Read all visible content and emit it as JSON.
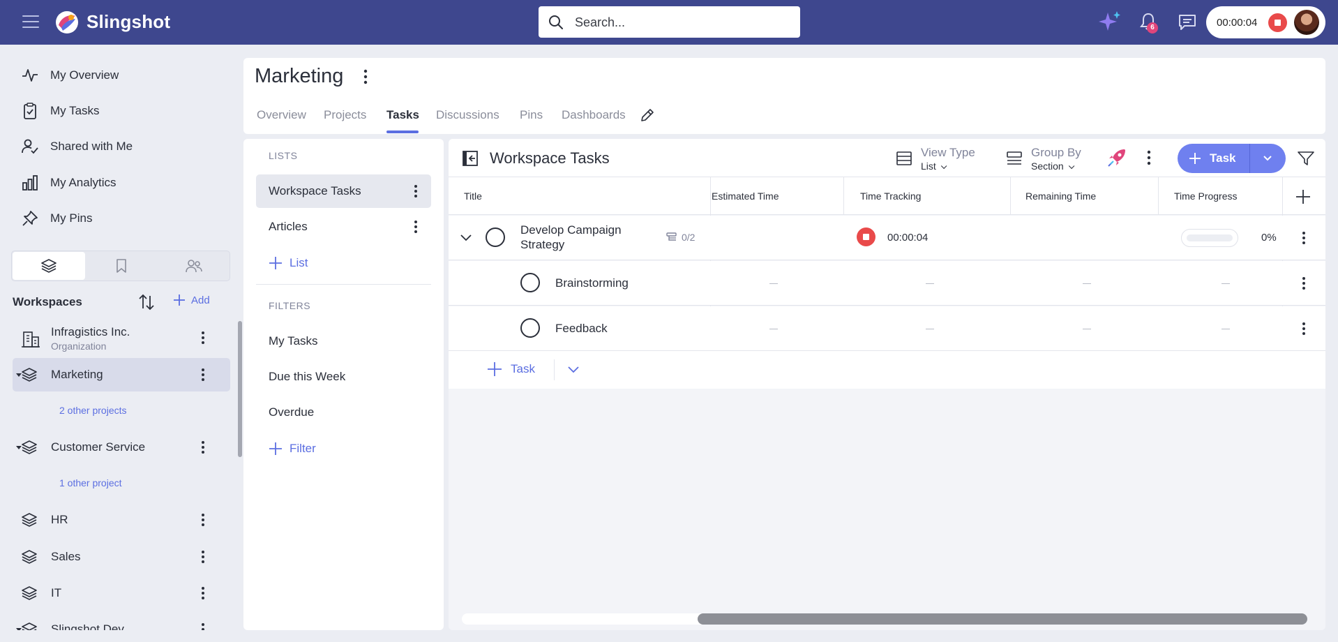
{
  "app": {
    "brand": "Slingshot"
  },
  "search": {
    "placeholder": "Search..."
  },
  "topbar": {
    "notifications_count": "6",
    "timer": "00:00:04"
  },
  "nav": {
    "items": [
      {
        "label": "My Overview",
        "icon": "activity-icon"
      },
      {
        "label": "My Tasks",
        "icon": "clipboard-check-icon"
      },
      {
        "label": "Shared with Me",
        "icon": "user-check-icon"
      },
      {
        "label": "My Analytics",
        "icon": "bar-chart-icon"
      },
      {
        "label": "My Pins",
        "icon": "pin-icon"
      }
    ]
  },
  "workspaces": {
    "title": "Workspaces",
    "add_label": "Add",
    "items": [
      {
        "name": "Infragistics Inc.",
        "sub": "Organization",
        "icon": "building-icon"
      },
      {
        "name": "Marketing",
        "icon": "layers-icon",
        "link": "2 other projects"
      },
      {
        "name": "Customer Service",
        "icon": "layers-icon",
        "link": "1 other project"
      },
      {
        "name": "HR",
        "icon": "layers-icon"
      },
      {
        "name": "Sales",
        "icon": "layers-icon"
      },
      {
        "name": "IT",
        "icon": "layers-icon"
      },
      {
        "name": "Slingshot Dev",
        "icon": "layers-icon"
      }
    ]
  },
  "page": {
    "title": "Marketing",
    "tabs": [
      "Overview",
      "Projects",
      "Tasks",
      "Discussions",
      "Pins",
      "Dashboards"
    ],
    "active_tab": "Tasks"
  },
  "lists": {
    "lists_label": "LISTS",
    "items": [
      "Workspace Tasks",
      "Articles"
    ],
    "add_list_label": "List",
    "filters_label": "FILTERS",
    "filters": [
      "My Tasks",
      "Due this Week",
      "Overdue"
    ],
    "add_filter_label": "Filter"
  },
  "main": {
    "title": "Workspace Tasks",
    "view_type_label": "View Type",
    "view_type_value": "List",
    "group_by_label": "Group By",
    "group_by_value": "Section",
    "task_button_label": "Task"
  },
  "table": {
    "columns": [
      "Title",
      "Estimated Time",
      "Time Tracking",
      "Remaining Time",
      "Time Progress"
    ],
    "rows": [
      {
        "title_line1": "Develop Campaign",
        "title_line2": "Strategy",
        "subtasks": "0/2",
        "time_tracking": "00:00:04",
        "progress": "0%",
        "progress_value": 0
      },
      {
        "title": "Brainstorming"
      },
      {
        "title": "Feedback"
      }
    ],
    "add_task_label": "Task"
  },
  "colors": {
    "topbar": "#3e478e",
    "accent": "#5b6ee1",
    "danger": "#e94a4a"
  }
}
